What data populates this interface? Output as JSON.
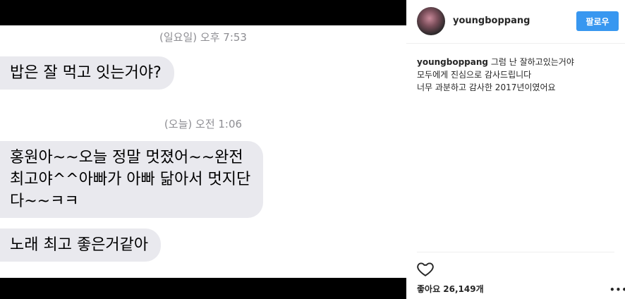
{
  "photo": {
    "timestamp1": {
      "day": "(일요일)",
      "time": "오후 7:53"
    },
    "message1": "밥은 잘 먹고 잇는거야?",
    "timestamp2": {
      "day": "(오늘)",
      "time": "오전 1:06"
    },
    "message2": "홍원아~~오늘 정말 멋졌어~~완전\n최고야^^아빠가 아빠 닮아서 멋지단\n다~~ㅋㅋ",
    "message3": "노래 최고 좋은거같아"
  },
  "post": {
    "username": "youngboppang",
    "follow_label": "팔로우",
    "caption_user": "youngboppang",
    "caption_line1": "그럼 난 잘하고있는거야",
    "caption_line2": "모두에게 진심으로 감사드립니다",
    "caption_line3": "너무 과분하고 감사한 2017년이였어요",
    "likes": "좋아요 26,149개",
    "more_icon": "more-dots-icon",
    "heart_icon": "heart-outline-icon"
  }
}
